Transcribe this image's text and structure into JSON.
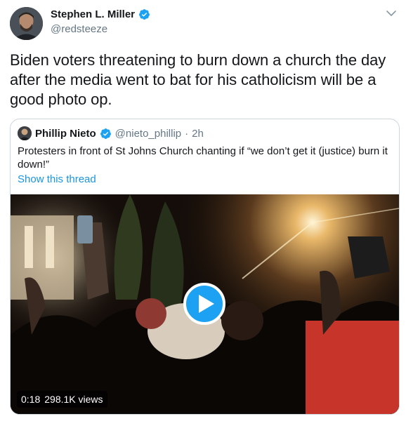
{
  "author": {
    "display_name": "Stephen L. Miller",
    "handle": "@redsteeze",
    "verified": true
  },
  "tweet_text": "Biden voters threatening to burn down a church the day after the media went to bat for his catholicism will be a good photo op.",
  "quoted": {
    "display_name": "Phillip Nieto",
    "handle": "@nieto_phillip",
    "separator": "·",
    "time": "2h",
    "verified": true,
    "text": "Protesters in front of St Johns Church chanting if “we don’t get it (justice) burn it down!”",
    "show_thread": "Show this thread",
    "video": {
      "duration": "0:18",
      "views": "298.1K views"
    }
  },
  "colors": {
    "accent": "#1da1f2",
    "link": "#1b95e0",
    "secondary_text": "#657786",
    "border": "#ccd6dd"
  },
  "icons": [
    "verified-badge-icon",
    "chevron-down-icon",
    "play-icon"
  ]
}
